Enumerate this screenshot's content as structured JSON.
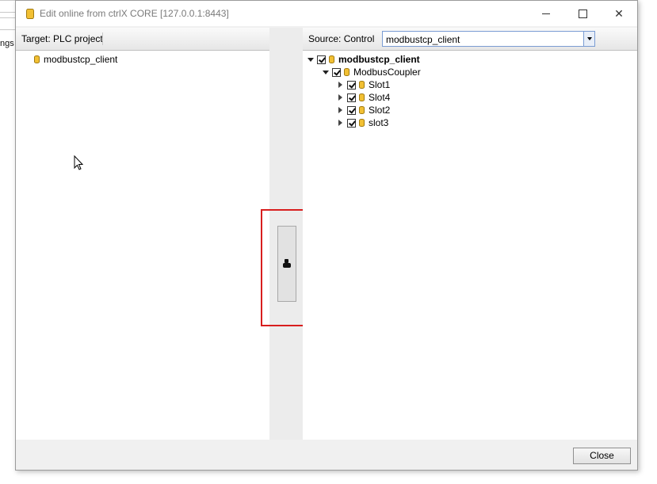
{
  "background": {
    "fragment_text": "ngs"
  },
  "window": {
    "title": "Edit online from ctrlX CORE [127.0.0.1:8443]",
    "controls": {
      "minimize": "minimize",
      "maximize": "maximize",
      "close": "✕"
    }
  },
  "left": {
    "header": "Target: PLC project",
    "tree": [
      {
        "label": "modbustcp_client",
        "icon": "database-icon"
      }
    ]
  },
  "middle": {
    "copy_button_icon": "copy-arrow-icon"
  },
  "right": {
    "header": "Source: Control",
    "dropdown": {
      "value": "modbustcp_client"
    },
    "tree": {
      "root": {
        "label": "modbustcp_client",
        "checked": true,
        "expanded": true
      },
      "child": {
        "label": "ModbusCoupler",
        "checked": true,
        "expanded": true
      },
      "slots": [
        {
          "label": "Slot1",
          "checked": true,
          "expanded": false
        },
        {
          "label": "Slot4",
          "checked": true,
          "expanded": false
        },
        {
          "label": "Slot2",
          "checked": true,
          "expanded": false
        },
        {
          "label": "slot3",
          "checked": true,
          "expanded": false
        }
      ]
    }
  },
  "footer": {
    "close_label": "Close"
  },
  "colors": {
    "highlight": "#d81e1e",
    "db_icon": "#f2c033",
    "dropdown_border": "#7a9cd3"
  }
}
